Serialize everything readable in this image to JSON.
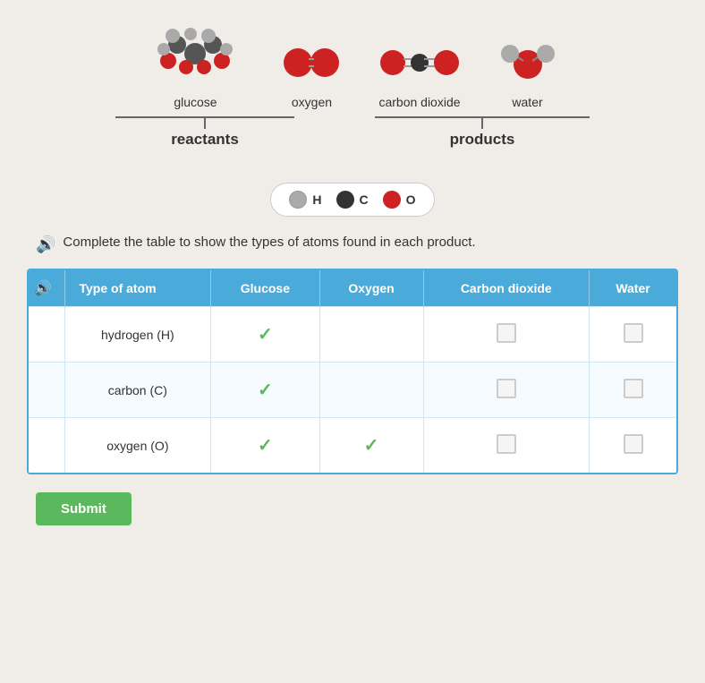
{
  "molecules": {
    "glucose": {
      "label": "glucose",
      "type": "complex"
    },
    "oxygen": {
      "label": "oxygen",
      "type": "diatomic"
    },
    "carbon_dioxide": {
      "label": "carbon dioxide",
      "type": "linear"
    },
    "water": {
      "label": "water",
      "type": "bent"
    }
  },
  "groups": {
    "reactants": "reactants",
    "products": "products"
  },
  "legend": {
    "items": [
      {
        "symbol": "H",
        "color": "#b0b0b0",
        "label": "H"
      },
      {
        "symbol": "C",
        "color": "#333333",
        "label": "C"
      },
      {
        "symbol": "O",
        "color": "#cc2222",
        "label": "O"
      }
    ]
  },
  "instruction": "Complete the table to show the types of atoms found in each product.",
  "table": {
    "headers": [
      "Type of atom",
      "Glucose",
      "Oxygen",
      "Carbon dioxide",
      "Water"
    ],
    "rows": [
      {
        "atom": "hydrogen (H)",
        "glucose": "check",
        "oxygen": "empty",
        "carbon_dioxide": "checkbox",
        "water": "checkbox"
      },
      {
        "atom": "carbon (C)",
        "glucose": "check",
        "oxygen": "empty",
        "carbon_dioxide": "empty",
        "water": "empty"
      },
      {
        "atom": "oxygen (O)",
        "glucose": "check",
        "oxygen": "check",
        "carbon_dioxide": "empty",
        "water": "empty"
      }
    ]
  },
  "submit_label": "Submit",
  "colors": {
    "header_bg": "#4AABDB",
    "check_color": "#5cb85c",
    "submit_bg": "#5cb85c"
  }
}
